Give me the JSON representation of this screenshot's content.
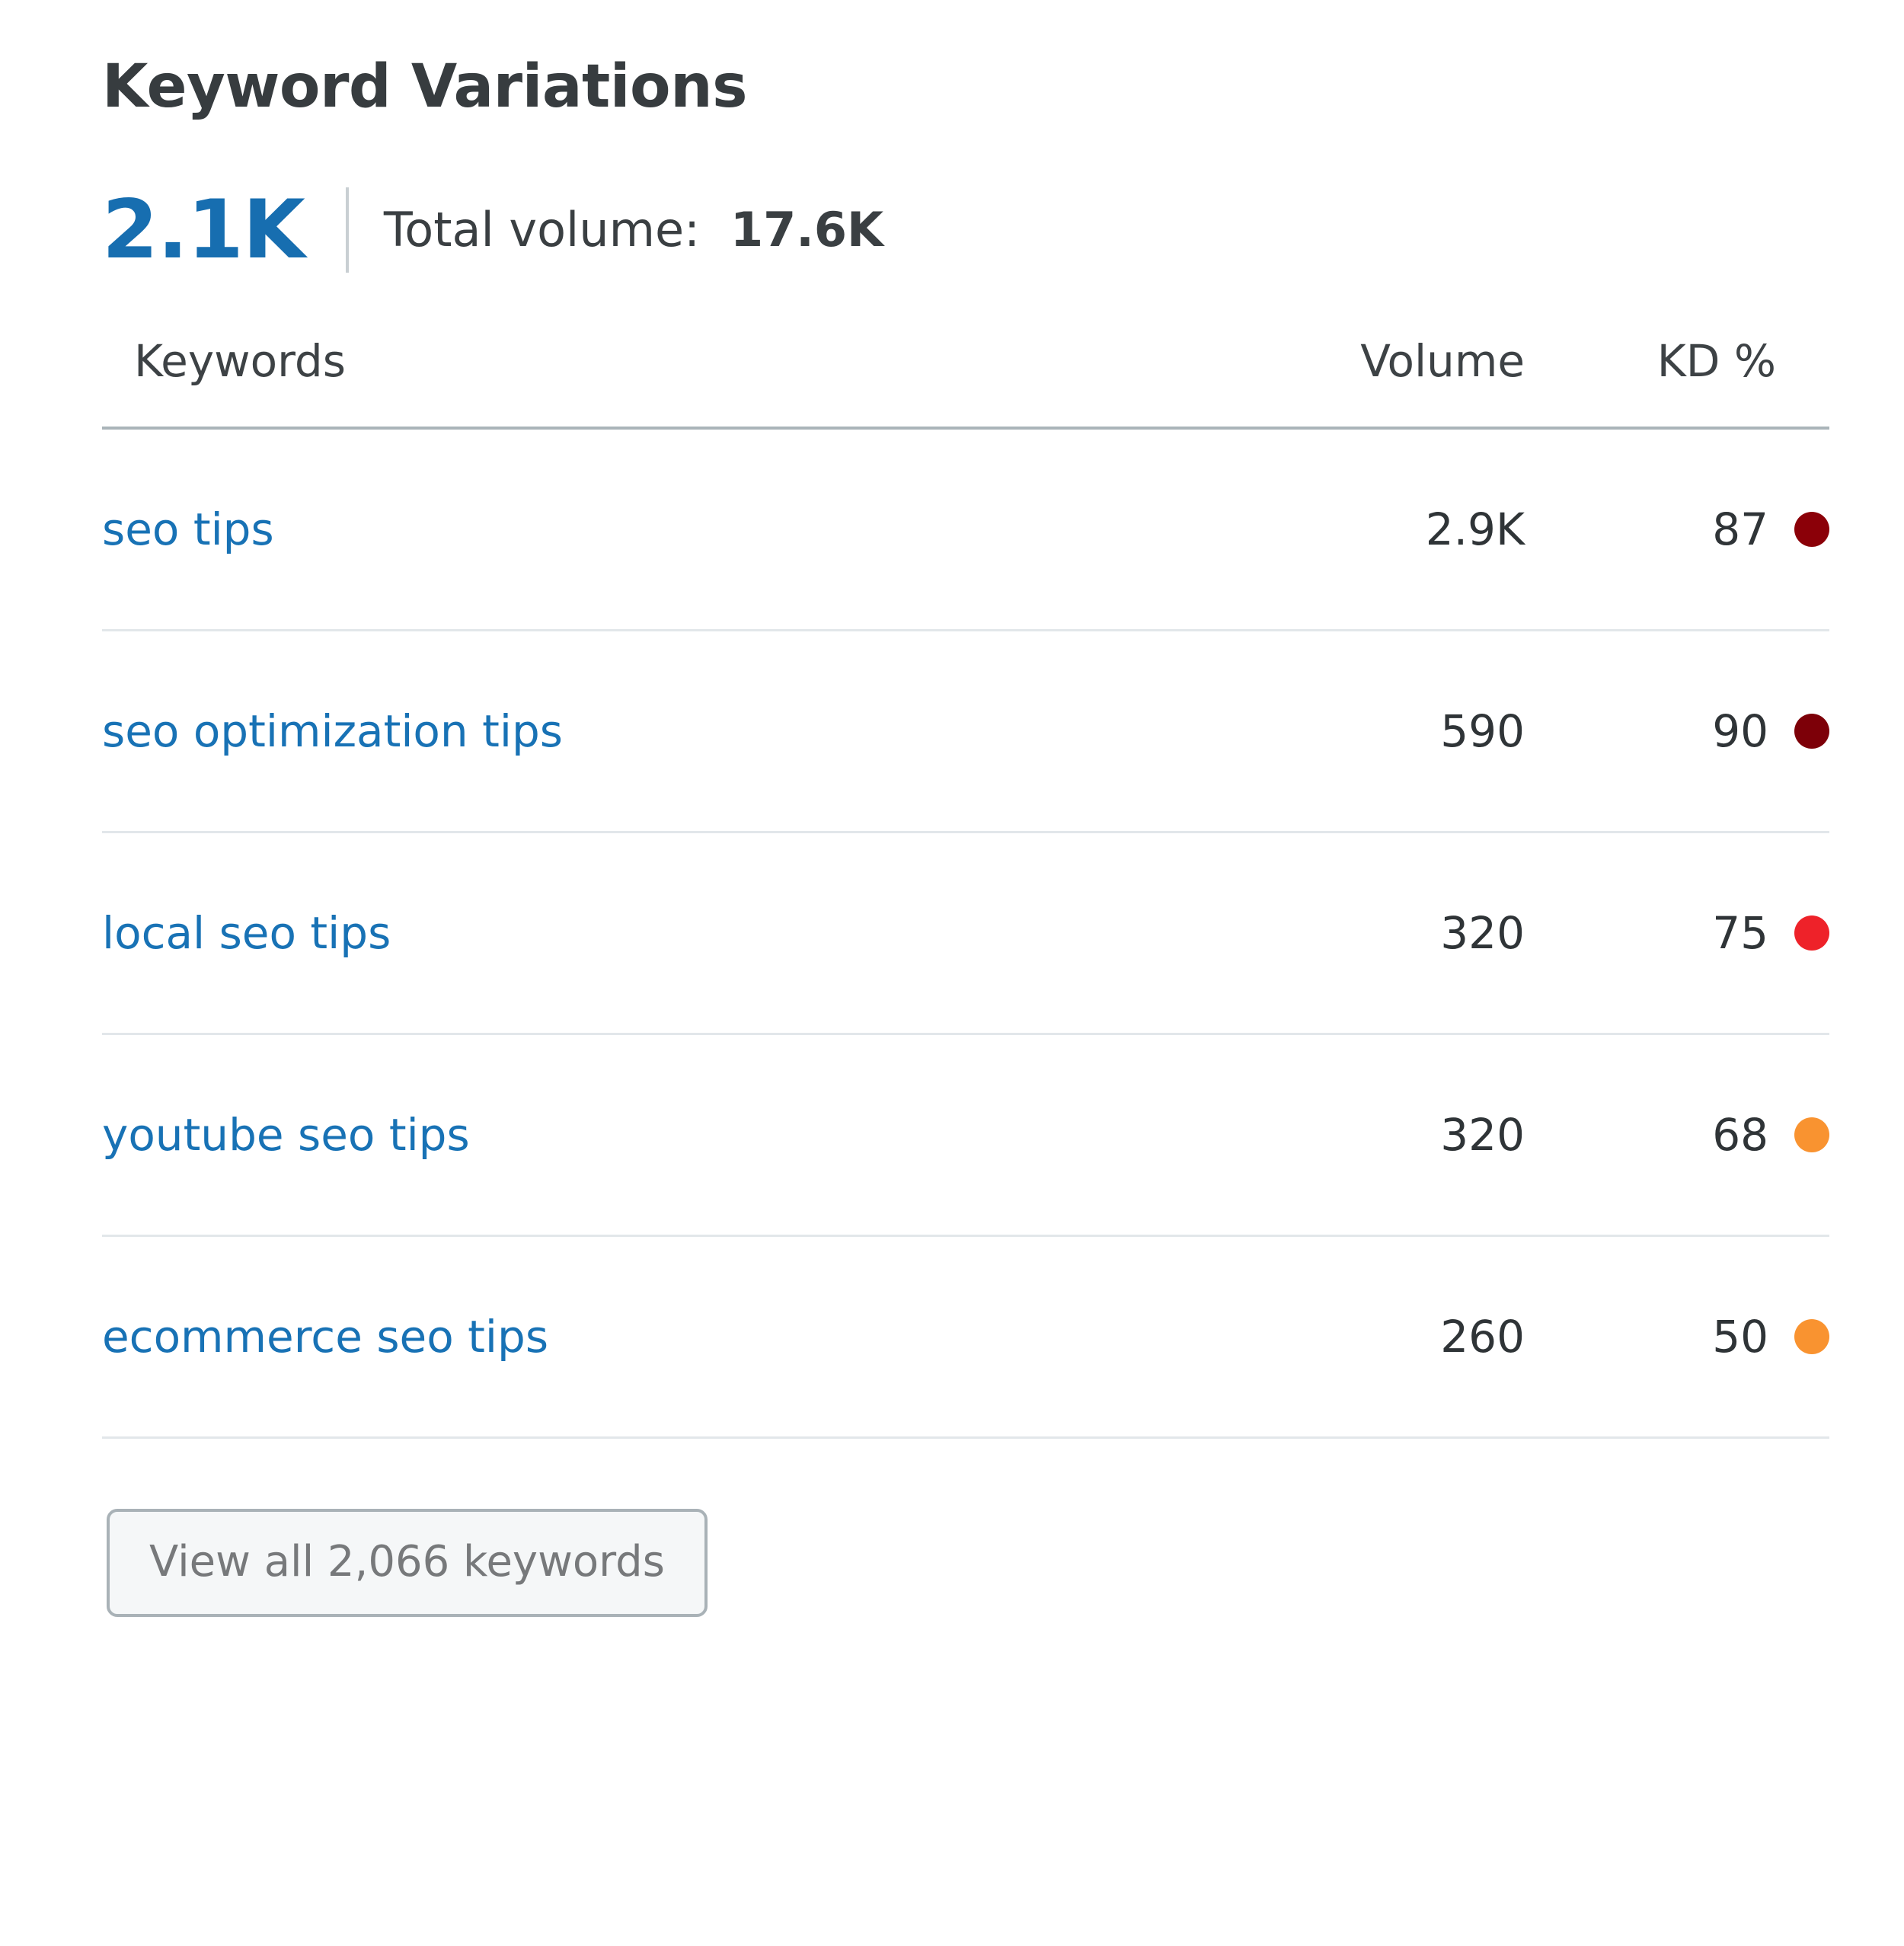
{
  "widget": {
    "title": "Keyword Variations"
  },
  "summary": {
    "total_keywords": "2.1K",
    "total_volume_label": "Total volume:",
    "total_volume_value": "17.6K",
    "accent_color": "#176eb0"
  },
  "table": {
    "headers": {
      "keyword": "Keywords",
      "volume": "Volume",
      "kd": "KD %"
    },
    "rows": [
      {
        "keyword": "seo tips",
        "volume": "2.9K",
        "kd": "87",
        "kd_color": "#8b0008"
      },
      {
        "keyword": "seo optimization tips",
        "volume": "590",
        "kd": "90",
        "kd_color": "#7d0008"
      },
      {
        "keyword": "local seo tips",
        "volume": "320",
        "kd": "75",
        "kd_color": "#ee2229"
      },
      {
        "keyword": "youtube seo tips",
        "volume": "320",
        "kd": "68",
        "kd_color": "#f99330"
      },
      {
        "keyword": "ecommerce seo tips",
        "volume": "260",
        "kd": "50",
        "kd_color": "#f99330"
      }
    ]
  },
  "footer": {
    "view_all_label": "View all 2,066 keywords"
  }
}
